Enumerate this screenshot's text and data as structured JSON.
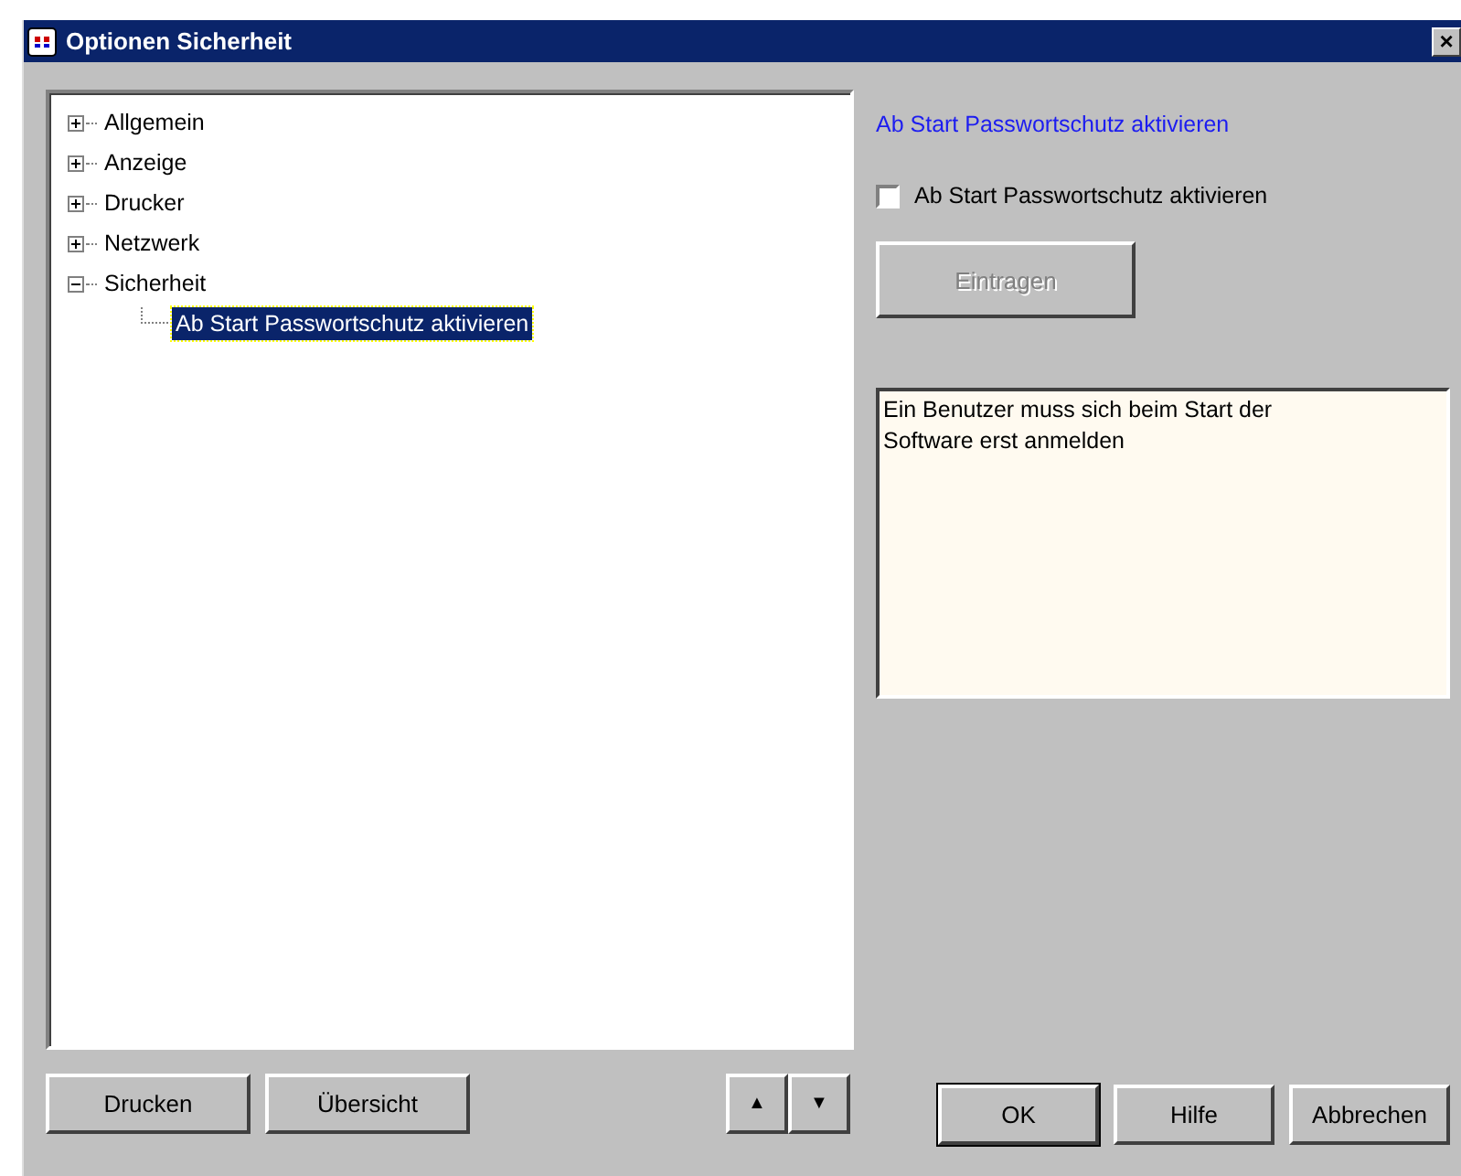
{
  "window": {
    "title": "Optionen Sicherheit",
    "close": "×"
  },
  "tree": [
    {
      "label": "Allgemein",
      "expanded": false,
      "selected": false
    },
    {
      "label": "Anzeige",
      "expanded": false,
      "selected": false
    },
    {
      "label": "Drucker",
      "expanded": false,
      "selected": false
    },
    {
      "label": "Netzwerk",
      "expanded": false,
      "selected": false
    },
    {
      "label": "Sicherheit",
      "expanded": true,
      "selected": false,
      "children": [
        {
          "label": "Ab Start Passwortschutz aktivieren",
          "selected": true
        }
      ]
    }
  ],
  "detail": {
    "heading": "Ab Start Passwortschutz aktivieren",
    "checkbox": {
      "label": "Ab Start Passwortschutz aktivieren",
      "checked": false
    },
    "apply_button": {
      "label": "Eintragen",
      "disabled": true
    },
    "description": "Ein Benutzer muss sich beim Start der Software erst anmelden"
  },
  "buttons_left": [
    "Drucken",
    "Übersicht"
  ],
  "arrows": [
    "▲",
    "▼"
  ],
  "buttons_right": [
    "OK",
    "Hilfe",
    "Abbrechen"
  ]
}
